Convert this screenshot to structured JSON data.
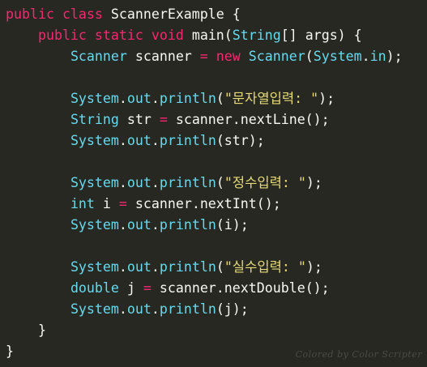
{
  "code": {
    "lines": [
      [
        {
          "t": "public",
          "c": "kw"
        },
        {
          "t": " "
        },
        {
          "t": "class",
          "c": "kw"
        },
        {
          "t": " ScannerExample {"
        }
      ],
      [
        {
          "t": "    "
        },
        {
          "t": "public",
          "c": "kw"
        },
        {
          "t": " "
        },
        {
          "t": "static",
          "c": "kw"
        },
        {
          "t": " "
        },
        {
          "t": "void",
          "c": "kw"
        },
        {
          "t": " main("
        },
        {
          "t": "String",
          "c": "ty"
        },
        {
          "t": "[] args) {"
        }
      ],
      [
        {
          "t": "        "
        },
        {
          "t": "Scanner",
          "c": "ty"
        },
        {
          "t": " scanner "
        },
        {
          "t": "=",
          "c": "kw"
        },
        {
          "t": " "
        },
        {
          "t": "new",
          "c": "kw"
        },
        {
          "t": " "
        },
        {
          "t": "Scanner",
          "c": "ty"
        },
        {
          "t": "("
        },
        {
          "t": "System",
          "c": "ty"
        },
        {
          "t": "."
        },
        {
          "t": "in",
          "c": "ty"
        },
        {
          "t": ");"
        }
      ],
      [],
      [
        {
          "t": "        "
        },
        {
          "t": "System",
          "c": "ty"
        },
        {
          "t": "."
        },
        {
          "t": "out",
          "c": "ty"
        },
        {
          "t": "."
        },
        {
          "t": "println",
          "c": "ty"
        },
        {
          "t": "("
        },
        {
          "t": "\"문자열입력: \"",
          "c": "str"
        },
        {
          "t": ");"
        }
      ],
      [
        {
          "t": "        "
        },
        {
          "t": "String",
          "c": "ty"
        },
        {
          "t": " str "
        },
        {
          "t": "=",
          "c": "kw"
        },
        {
          "t": " scanner.nextLine();"
        }
      ],
      [
        {
          "t": "        "
        },
        {
          "t": "System",
          "c": "ty"
        },
        {
          "t": "."
        },
        {
          "t": "out",
          "c": "ty"
        },
        {
          "t": "."
        },
        {
          "t": "println",
          "c": "ty"
        },
        {
          "t": "(str);"
        }
      ],
      [],
      [
        {
          "t": "        "
        },
        {
          "t": "System",
          "c": "ty"
        },
        {
          "t": "."
        },
        {
          "t": "out",
          "c": "ty"
        },
        {
          "t": "."
        },
        {
          "t": "println",
          "c": "ty"
        },
        {
          "t": "("
        },
        {
          "t": "\"정수입력: \"",
          "c": "str"
        },
        {
          "t": ");"
        }
      ],
      [
        {
          "t": "        "
        },
        {
          "t": "int",
          "c": "ty"
        },
        {
          "t": " i "
        },
        {
          "t": "=",
          "c": "kw"
        },
        {
          "t": " scanner.nextInt();"
        }
      ],
      [
        {
          "t": "        "
        },
        {
          "t": "System",
          "c": "ty"
        },
        {
          "t": "."
        },
        {
          "t": "out",
          "c": "ty"
        },
        {
          "t": "."
        },
        {
          "t": "println",
          "c": "ty"
        },
        {
          "t": "(i);"
        }
      ],
      [],
      [
        {
          "t": "        "
        },
        {
          "t": "System",
          "c": "ty"
        },
        {
          "t": "."
        },
        {
          "t": "out",
          "c": "ty"
        },
        {
          "t": "."
        },
        {
          "t": "println",
          "c": "ty"
        },
        {
          "t": "("
        },
        {
          "t": "\"실수입력: \"",
          "c": "str"
        },
        {
          "t": ");"
        }
      ],
      [
        {
          "t": "        "
        },
        {
          "t": "double",
          "c": "ty"
        },
        {
          "t": " j "
        },
        {
          "t": "=",
          "c": "kw"
        },
        {
          "t": " scanner.nextDouble();"
        }
      ],
      [
        {
          "t": "        "
        },
        {
          "t": "System",
          "c": "ty"
        },
        {
          "t": "."
        },
        {
          "t": "out",
          "c": "ty"
        },
        {
          "t": "."
        },
        {
          "t": "println",
          "c": "ty"
        },
        {
          "t": "(j);"
        }
      ],
      [
        {
          "t": "    }"
        }
      ],
      [
        {
          "t": "}"
        }
      ]
    ]
  },
  "watermark": "Colored by Color Scripter",
  "colors": {
    "background": "#272822",
    "plain": "#f8f8f2",
    "keyword": "#f92672",
    "type": "#66d9ef",
    "string": "#e6db74"
  }
}
